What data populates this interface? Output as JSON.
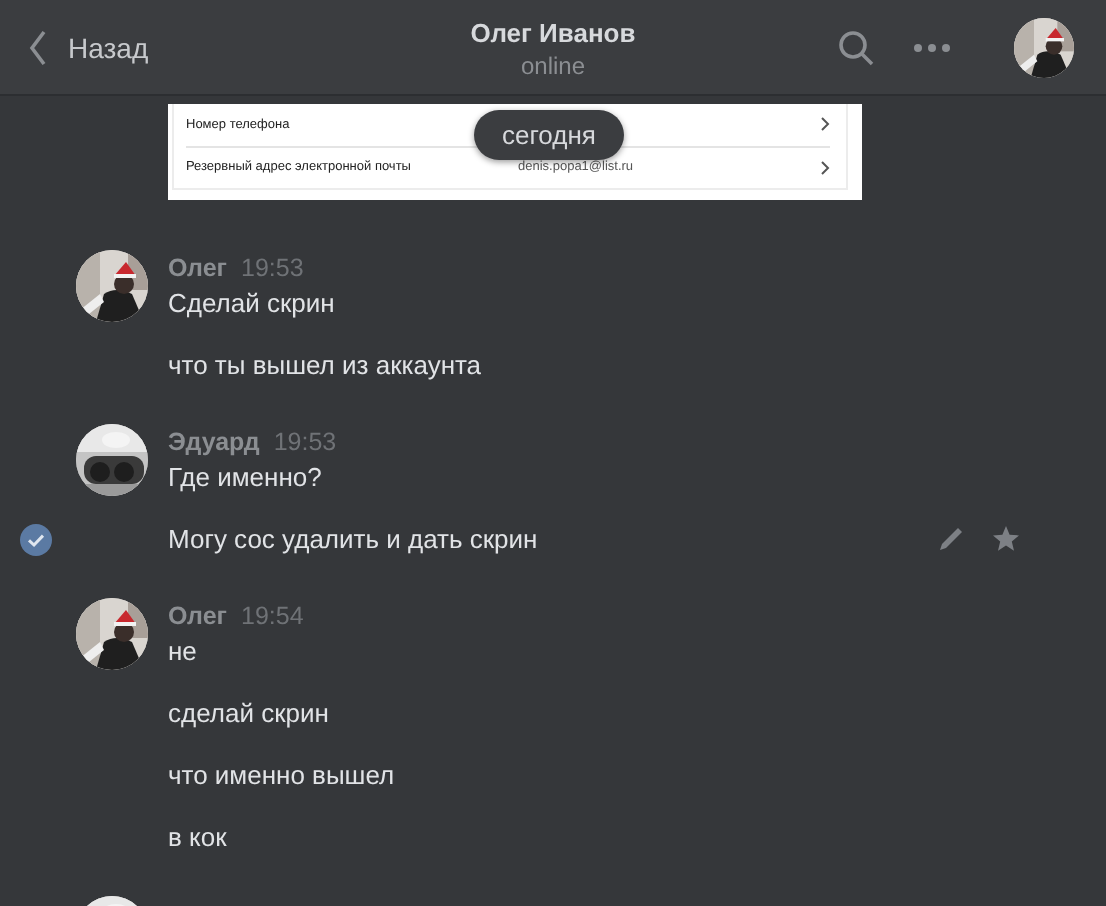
{
  "header": {
    "back_label": "Назад",
    "title": "Олег Иванов",
    "status": "online",
    "avatar": {
      "kind": "picture"
    }
  },
  "attachment": {
    "kind": "screenshot",
    "rows": [
      {
        "label": "Номер телефона",
        "value": ""
      },
      {
        "label": "Резервный адрес электронной почты",
        "value": "denis.popa1@list.ru"
      }
    ]
  },
  "date_pill": "сегодня",
  "groups": [
    {
      "author": "Олег",
      "time": "19:53",
      "avatar": {
        "kind": "picture"
      },
      "messages": [
        {
          "text": "Сделай скрин",
          "selected": false
        },
        {
          "text": "что ты вышел из аккаунта",
          "selected": false
        }
      ]
    },
    {
      "author": "Эдуард",
      "time": "19:53",
      "avatar": {
        "kind": "picture"
      },
      "messages": [
        {
          "text": "Где именно?",
          "selected": false
        },
        {
          "text": "Могу сос удалить и дать скрин",
          "selected": true
        }
      ]
    },
    {
      "author": "Олег",
      "time": "19:54",
      "avatar": {
        "kind": "picture"
      },
      "messages": [
        {
          "text": "не",
          "selected": false
        },
        {
          "text": "сделай скрин",
          "selected": false
        },
        {
          "text": "что именно вышел",
          "selected": false
        },
        {
          "text": "в кок",
          "selected": false
        }
      ]
    }
  ],
  "partial_avatar": {
    "kind": "picture"
  }
}
